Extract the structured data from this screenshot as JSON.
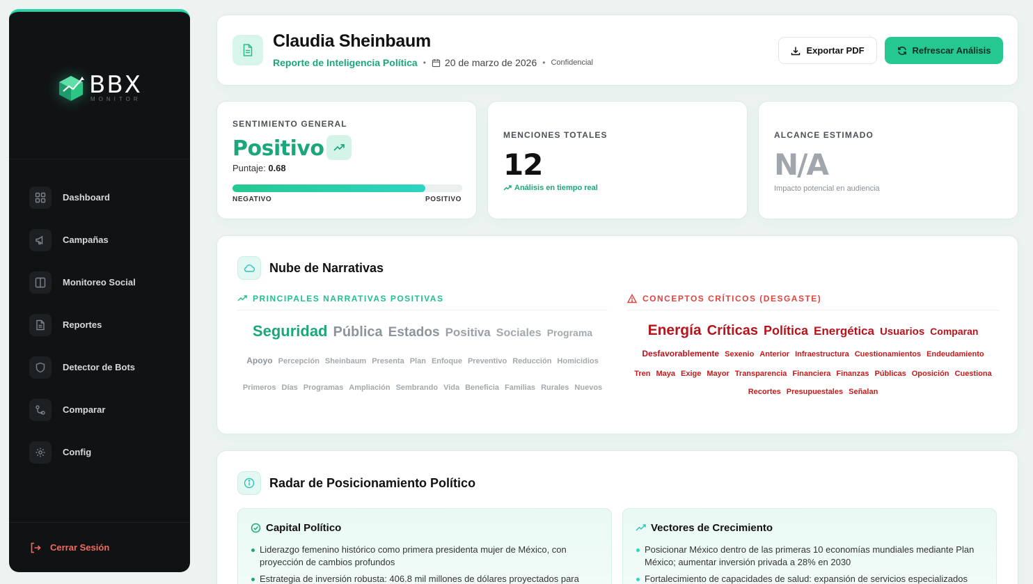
{
  "brand": {
    "name": "BBX",
    "sub": "MONITOR"
  },
  "nav": [
    {
      "label": "Dashboard",
      "icon": "grid-icon"
    },
    {
      "label": "Campañas",
      "icon": "megaphone-icon"
    },
    {
      "label": "Monitoreo Social",
      "icon": "columns-icon"
    },
    {
      "label": "Reportes",
      "icon": "document-icon"
    },
    {
      "label": "Detector de Bots",
      "icon": "shield-icon"
    },
    {
      "label": "Comparar",
      "icon": "git-compare-icon"
    },
    {
      "label": "Config",
      "icon": "gear-icon"
    }
  ],
  "logout_label": "Cerrar Sesión",
  "header": {
    "name": "Claudia Sheinbaum",
    "report": "Reporte de Inteligencia Política",
    "date": "20 de marzo de 2026",
    "confidential": "Confidencial",
    "export_label": "Exportar PDF",
    "refresh_label": "Refrescar Análisis"
  },
  "sentiment": {
    "title": "SENTIMIENTO GENERAL",
    "value": "Positivo",
    "score_label": "Puntaje:",
    "score": "0.68",
    "bar_fraction": 0.84,
    "neg_label": "NEGATIVO",
    "pos_label": "POSITIVO"
  },
  "mentions": {
    "title": "MENCIONES TOTALES",
    "value": "12",
    "note": "Análisis en tiempo real"
  },
  "reach": {
    "title": "ALCANCE ESTIMADO",
    "value": "N/A",
    "note": "Impacto potencial en audiencia"
  },
  "cloud": {
    "title": "Nube de Narrativas",
    "positive_title": "PRINCIPALES NARRATIVAS POSITIVAS",
    "negative_title": "CONCEPTOS CRÍTICOS (DESGASTE)",
    "positive_rows": [
      [
        [
          "Seguridad",
          22,
          "#1aa77c"
        ],
        [
          "Pública",
          20,
          "#8d949b"
        ],
        [
          "Estados",
          19,
          "#8d949b"
        ],
        [
          "Positiva",
          17,
          "#9aa0a6"
        ],
        [
          "Sociales",
          16,
          "#a3a8ad"
        ],
        [
          "Programa",
          14,
          "#a3a8ad"
        ]
      ],
      [
        [
          "Apoyo",
          12,
          "#8d949b"
        ],
        [
          "Percepción",
          11,
          "#a3a8ad"
        ],
        [
          "Sheinbaum",
          11,
          "#a3a8ad"
        ],
        [
          "Presenta",
          11,
          "#a3a8ad"
        ],
        [
          "Plan",
          11,
          "#a3a8ad"
        ],
        [
          "Enfoque",
          11,
          "#a3a8ad"
        ],
        [
          "Preventivo",
          11,
          "#a3a8ad"
        ],
        [
          "Reducción",
          11,
          "#a3a8ad"
        ],
        [
          "Homicidios",
          11,
          "#a3a8ad"
        ]
      ],
      [
        [
          "Primeros",
          11,
          "#a3a8ad"
        ],
        [
          "Días",
          11,
          "#a3a8ad"
        ],
        [
          "Programas",
          11,
          "#a3a8ad"
        ],
        [
          "Ampliación",
          11,
          "#a3a8ad"
        ],
        [
          "Sembrando",
          11,
          "#a3a8ad"
        ],
        [
          "Vida",
          11,
          "#a3a8ad"
        ],
        [
          "Beneficia",
          11,
          "#a3a8ad"
        ],
        [
          "Familias",
          11,
          "#a3a8ad"
        ],
        [
          "Rurales",
          11,
          "#a3a8ad"
        ],
        [
          "Nuevos",
          11,
          "#a3a8ad"
        ]
      ]
    ],
    "negative_rows": [
      [
        [
          "Energía",
          21,
          "#b8131b"
        ],
        [
          "Críticas",
          20,
          "#b8131b"
        ],
        [
          "Política",
          18,
          "#b8131b"
        ],
        [
          "Energética",
          17,
          "#b8131b"
        ],
        [
          "Usuarios",
          15,
          "#b8131b"
        ],
        [
          "Comparan",
          14,
          "#b8131b"
        ]
      ],
      [
        [
          "Desfavorablemente",
          12,
          "#b8131b"
        ],
        [
          "Sexenio",
          11,
          "#c21b1b"
        ],
        [
          "Anterior",
          11,
          "#c21b1b"
        ],
        [
          "Infraestructura",
          11,
          "#c21b1b"
        ],
        [
          "Cuestionamientos",
          11,
          "#c21b1b"
        ],
        [
          "Endeudamiento",
          11,
          "#c21b1b"
        ]
      ],
      [
        [
          "Tren",
          11,
          "#c21b1b"
        ],
        [
          "Maya",
          11,
          "#c21b1b"
        ],
        [
          "Exige",
          11,
          "#c21b1b"
        ],
        [
          "Mayor",
          11,
          "#c21b1b"
        ],
        [
          "Transparencia",
          11,
          "#c21b1b"
        ],
        [
          "Financiera",
          11,
          "#c21b1b"
        ],
        [
          "Finanzas",
          11,
          "#c21b1b"
        ],
        [
          "Públicas",
          11,
          "#c21b1b"
        ],
        [
          "Oposición",
          11,
          "#c21b1b"
        ],
        [
          "Cuestiona",
          11,
          "#c21b1b"
        ]
      ],
      [
        [
          "Recortes",
          11,
          "#c21b1b"
        ],
        [
          "Presupuestales",
          11,
          "#c21b1b"
        ],
        [
          "Señalan",
          11,
          "#c21b1b"
        ]
      ]
    ]
  },
  "radar": {
    "title": "Radar de Posicionamiento Político",
    "capital": {
      "title": "Capital Político",
      "items": [
        "Liderazgo femenino histórico como primera presidenta mujer de México, con proyección de cambios profundos",
        "Estrategia de inversión robusta: 406.8 mil millones de dólares proyectados para"
      ]
    },
    "growth": {
      "title": "Vectores de Crecimiento",
      "items": [
        "Posicionar México dentro de las primeras 10 economías mundiales mediante Plan México; aumentar inversión privada a 28% en 2030",
        "Fortalecimiento de capacidades de salud: expansión de servicios especializados"
      ]
    }
  },
  "colors": {
    "accent": "#25c891",
    "positive_text": "#1aa77c",
    "critical_text": "#e0443d",
    "sidebar_bg": "#111213"
  }
}
